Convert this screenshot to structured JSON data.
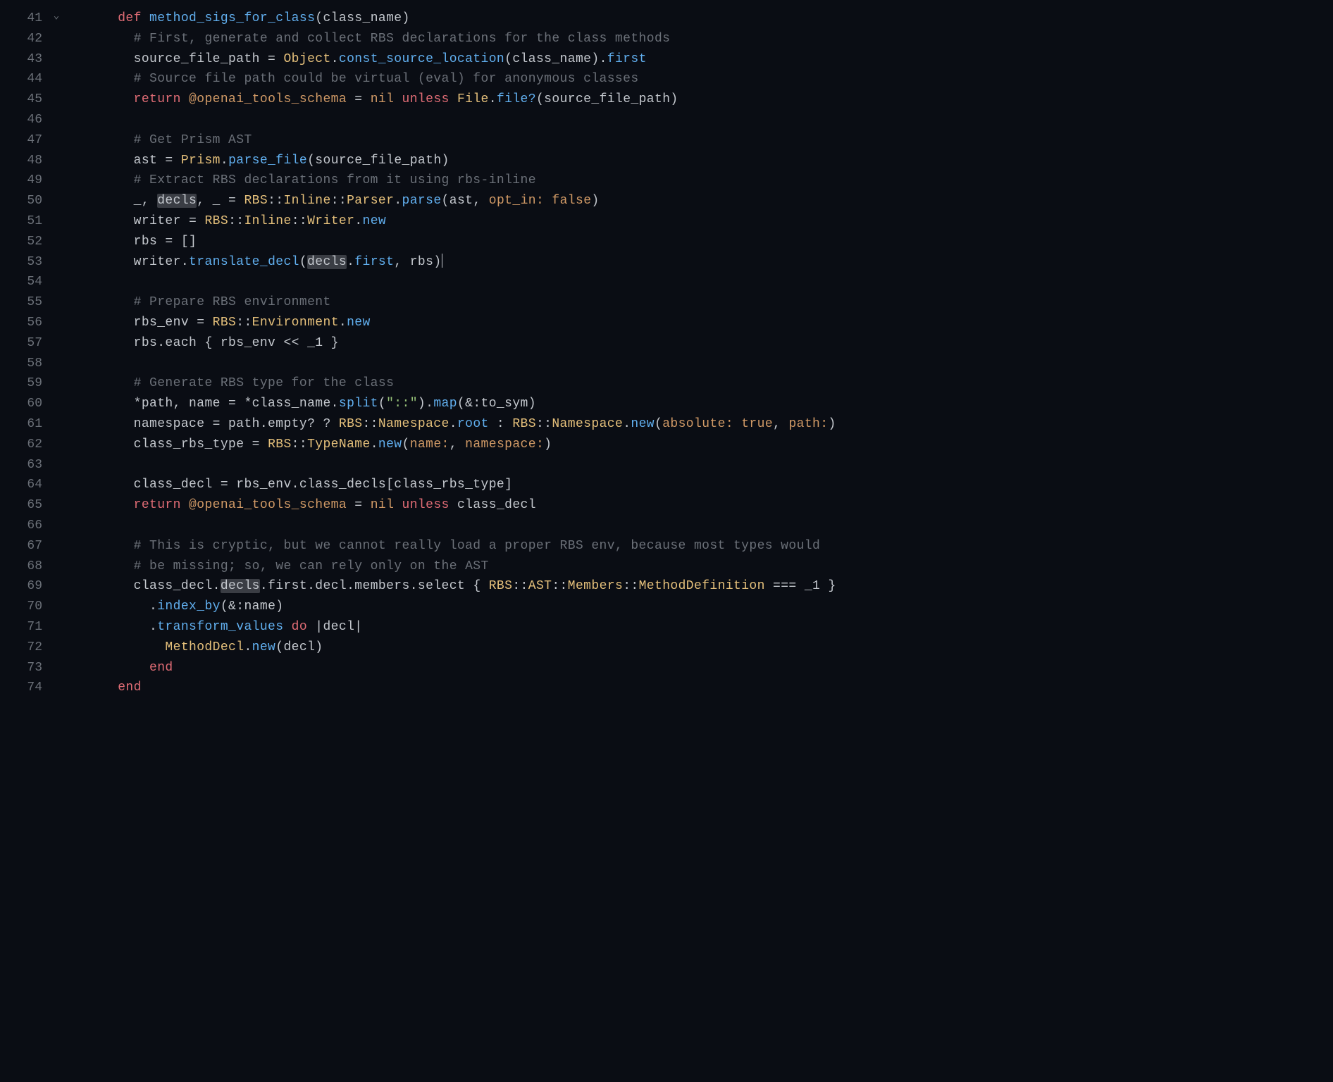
{
  "lines": [
    {
      "num": "41",
      "fold": "⌄"
    },
    {
      "num": "42"
    },
    {
      "num": "43"
    },
    {
      "num": "44"
    },
    {
      "num": "45"
    },
    {
      "num": "46"
    },
    {
      "num": "47"
    },
    {
      "num": "48"
    },
    {
      "num": "49"
    },
    {
      "num": "50"
    },
    {
      "num": "51"
    },
    {
      "num": "52"
    },
    {
      "num": "53"
    },
    {
      "num": "54"
    },
    {
      "num": "55"
    },
    {
      "num": "56"
    },
    {
      "num": "57"
    },
    {
      "num": "58"
    },
    {
      "num": "59"
    },
    {
      "num": "60"
    },
    {
      "num": "61"
    },
    {
      "num": "62"
    },
    {
      "num": "63"
    },
    {
      "num": "64"
    },
    {
      "num": "65"
    },
    {
      "num": "66"
    },
    {
      "num": "67"
    },
    {
      "num": "68"
    },
    {
      "num": "69"
    },
    {
      "num": "70"
    },
    {
      "num": "71"
    },
    {
      "num": "72"
    },
    {
      "num": "73"
    },
    {
      "num": "74"
    }
  ],
  "code": {
    "l41": {
      "indent": "      ",
      "def": "def",
      "name": "method_sigs_for_class",
      "params": "(class_name)"
    },
    "l42": {
      "indent": "        ",
      "comment": "# First, generate and collect RBS declarations for the class methods"
    },
    "l43": {
      "indent": "        ",
      "var": "source_file_path",
      "eq": " = ",
      "const": "Object",
      "dot1": ".",
      "fn1": "const_source_location",
      "args1": "(class_name)",
      "dot2": ".",
      "fn2": "first"
    },
    "l44": {
      "indent": "        ",
      "comment": "# Source file path could be virtual (eval) for anonymous classes"
    },
    "l45": {
      "indent": "        ",
      "return": "return",
      "sp1": " ",
      "ivar": "@openai_tools_schema",
      "eq": " = ",
      "nil": "nil",
      "sp2": " ",
      "unless": "unless",
      "sp3": " ",
      "const": "File",
      "dot": ".",
      "fn": "file?",
      "args": "(source_file_path)"
    },
    "l47": {
      "indent": "        ",
      "comment": "# Get Prism AST"
    },
    "l48": {
      "indent": "        ",
      "var": "ast",
      "eq": " = ",
      "const": "Prism",
      "dot": ".",
      "fn": "parse_file",
      "args": "(source_file_path)"
    },
    "l49": {
      "indent": "        ",
      "comment": "# Extract RBS declarations from it using rbs-inline"
    },
    "l50": {
      "indent": "        ",
      "pre": "_, ",
      "decls": "decls",
      "post": ", _ = ",
      "c1": "RBS",
      "cc1": "::",
      "c2": "Inline",
      "cc2": "::",
      "c3": "Parser",
      "dot": ".",
      "fn": "parse",
      "args_open": "(ast, ",
      "sym": "opt_in:",
      "sp": " ",
      "bool": "false",
      "args_close": ")"
    },
    "l51": {
      "indent": "        ",
      "var": "writer",
      "eq": " = ",
      "c1": "RBS",
      "cc1": "::",
      "c2": "Inline",
      "cc2": "::",
      "c3": "Writer",
      "dot": ".",
      "fn": "new"
    },
    "l52": {
      "indent": "        ",
      "var": "rbs",
      "eq": " = []"
    },
    "l53": {
      "indent": "        ",
      "var": "writer",
      "dot1": ".",
      "fn1": "translate_decl",
      "open": "(",
      "decls": "decls",
      "dot2": ".",
      "fn2": "first",
      "rest": ", rbs)"
    },
    "l55": {
      "indent": "        ",
      "comment": "# Prepare RBS environment"
    },
    "l56": {
      "indent": "        ",
      "var": "rbs_env",
      "eq": " = ",
      "c1": "RBS",
      "cc1": "::",
      "c2": "Environment",
      "dot": ".",
      "fn": "new"
    },
    "l57": {
      "indent": "        ",
      "text": "rbs.each { rbs_env << _1 }"
    },
    "l59": {
      "indent": "        ",
      "comment": "# Generate RBS type for the class"
    },
    "l60": {
      "indent": "        ",
      "pre": "*path, name = *class_name.",
      "fn1": "split",
      "open": "(",
      "str": "\"::\"",
      "close": ").",
      "fn2": "map",
      "args": "(&:to_sym)"
    },
    "l61": {
      "indent": "        ",
      "pre": "namespace = path.empty? ? ",
      "c1": "RBS",
      "cc1": "::",
      "c2": "Namespace",
      "dot1": ".",
      "fn1": "root",
      "mid": " : ",
      "c3": "RBS",
      "cc2": "::",
      "c4": "Namespace",
      "dot2": ".",
      "fn2": "new",
      "open": "(",
      "sym1": "absolute:",
      "sp1": " ",
      "bool": "true",
      "comma": ", ",
      "sym2": "path:",
      "close": ")"
    },
    "l62": {
      "indent": "        ",
      "var": "class_rbs_type",
      "eq": " = ",
      "c1": "RBS",
      "cc1": "::",
      "c2": "TypeName",
      "dot": ".",
      "fn": "new",
      "open": "(",
      "sym1": "name:",
      "comma": ", ",
      "sym2": "namespace:",
      "close": ")"
    },
    "l64": {
      "indent": "        ",
      "text": "class_decl = rbs_env.class_decls[class_rbs_type]"
    },
    "l65": {
      "indent": "        ",
      "return": "return",
      "sp1": " ",
      "ivar": "@openai_tools_schema",
      "eq": " = ",
      "nil": "nil",
      "sp2": " ",
      "unless": "unless",
      "sp3": " ",
      "var": "class_decl"
    },
    "l67": {
      "indent": "        ",
      "comment": "# This is cryptic, but we cannot really load a proper RBS env, because most types would"
    },
    "l68": {
      "indent": "        ",
      "comment": "# be missing; so, we can rely only on the AST"
    },
    "l69": {
      "indent": "        ",
      "pre": "class_decl.",
      "decls": "decls",
      "dot1": ".first.decl.members.select { ",
      "c1": "RBS",
      "cc1": "::",
      "c2": "AST",
      "cc2": "::",
      "c3": "Members",
      "cc3": "::",
      "c4": "MethodDefinition",
      "op": " === ",
      "post": "_1 }"
    },
    "l70": {
      "indent": "          ",
      "dot": ".",
      "fn": "index_by",
      "args": "(&:name)"
    },
    "l71": {
      "indent": "          ",
      "dot": ".",
      "fn": "transform_values",
      "sp": " ",
      "do": "do",
      "args": " |decl|"
    },
    "l72": {
      "indent": "            ",
      "const": "MethodDecl",
      "dot": ".",
      "fn": "new",
      "args": "(decl)"
    },
    "l73": {
      "indent": "          ",
      "end": "end"
    },
    "l74": {
      "indent": "      ",
      "end": "end"
    }
  }
}
